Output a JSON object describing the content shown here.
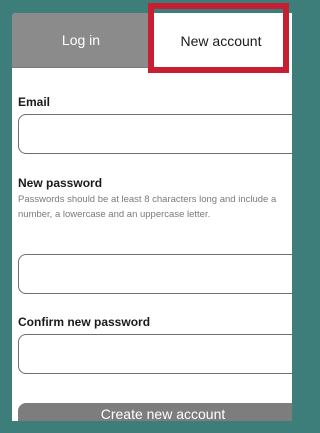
{
  "colors": {
    "background": "#3d7d7a",
    "card": "#ffffff",
    "tab_inactive": "#8b8b8b",
    "highlight": "#c61f32",
    "button": "#7d7d7d"
  },
  "tabs": {
    "login_label": "Log in",
    "new_account_label": "New account",
    "active": "New account"
  },
  "form": {
    "email": {
      "label": "Email",
      "value": ""
    },
    "new_password": {
      "label": "New password",
      "help": "Passwords should be at least 8 characters long and include a number, a lowercase and an uppercase letter.",
      "value": ""
    },
    "confirm_password": {
      "label": "Confirm new password",
      "value": ""
    },
    "submit_label": "Create new account"
  }
}
